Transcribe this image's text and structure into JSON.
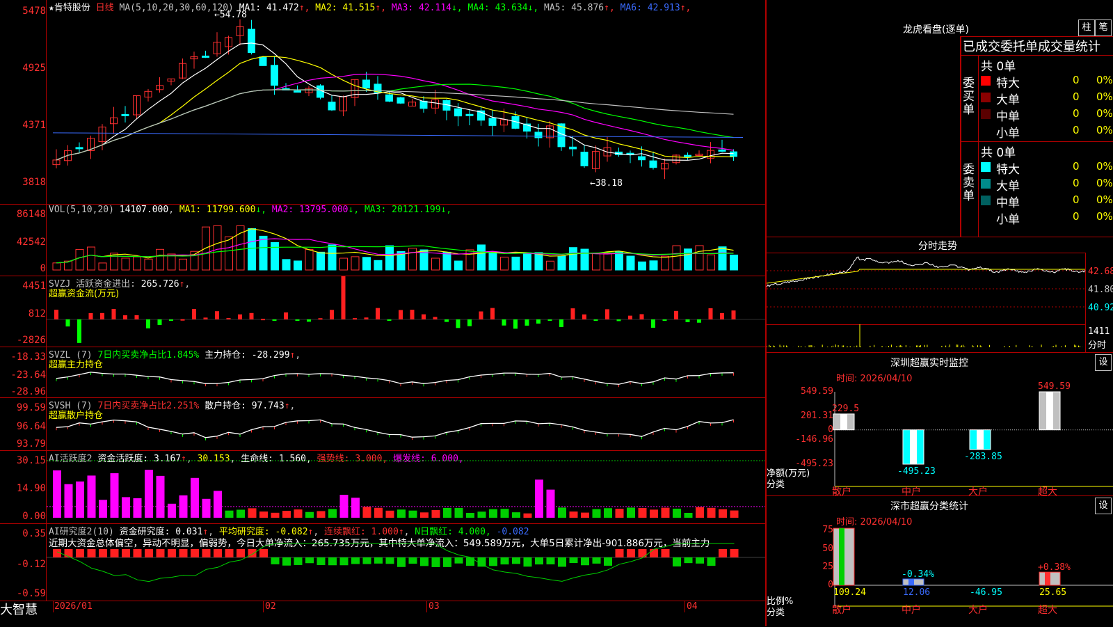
{
  "stock": {
    "star": "★",
    "name": "肯特股份",
    "period": "日线"
  },
  "ma_legend": {
    "label": "MA(5,10,20,30,60,120)",
    "items": [
      {
        "name": "MA1:",
        "value": "41.472",
        "arrow": "↑",
        "color": "#ffffff"
      },
      {
        "name": "MA2:",
        "value": "41.515",
        "arrow": "↑",
        "color": "#ffff00"
      },
      {
        "name": "MA3:",
        "value": "42.114",
        "arrow": "↓",
        "color": "#ff00ff"
      },
      {
        "name": "MA4:",
        "value": "43.634",
        "arrow": "↓",
        "color": "#00ff00"
      },
      {
        "name": "MA5:",
        "value": "45.876",
        "arrow": "↑",
        "color": "#c0c0c0"
      },
      {
        "name": "MA6:",
        "value": "42.913",
        "arrow": "↑",
        "color": "#3a6bff"
      }
    ]
  },
  "price_axis": [
    "5478",
    "4925",
    "4371",
    "3818"
  ],
  "price_markers": {
    "high": "54.78",
    "low": "38.18"
  },
  "vol_legend": {
    "label": "VOL(5,10,20)",
    "value": "14107.000",
    "items": [
      {
        "name": "MA1:",
        "value": "11799.600",
        "arrow": "↓",
        "color": "#ffff00"
      },
      {
        "name": "MA2:",
        "value": "13795.000",
        "arrow": "↓",
        "color": "#ff00ff"
      },
      {
        "name": "MA3:",
        "value": "20121.199",
        "arrow": "↓",
        "color": "#00ff00"
      }
    ]
  },
  "vol_axis": [
    "86148",
    "42542",
    "0"
  ],
  "svzj": {
    "title": "SVZJ  活跃资金进出:",
    "value": "265.726",
    "arrow": "↑",
    "sub": "超赢资金流(万元)"
  },
  "svzj_axis": [
    "4451",
    "812",
    "-2826"
  ],
  "svzl": {
    "title": "SVZL (7)",
    "desc": "7日内买卖净占比1.845%",
    "label": "主力持仓:",
    "value": "-28.299",
    "sub": "超赢主力持仓"
  },
  "svzl_axis": [
    "-18.33",
    "-23.64",
    "-28.96"
  ],
  "svsh": {
    "title": "SVSH (7)",
    "desc": "7日内买卖净占比2.251%",
    "label": "散户持仓:",
    "value": "97.743",
    "sub": "超赢散户持仓"
  },
  "svsh_axis": [
    "99.59",
    "96.64",
    "93.79"
  ],
  "ai_active": {
    "title": "AI活跃度2",
    "label": "资金活跃度:",
    "value": "3.167",
    "v2": "30.153",
    "life": "生命线: 1.560,",
    "strong": "强势线: 3.000,",
    "burst": "爆发线: 6.000,"
  },
  "ai_active_axis": [
    "30.15",
    "14.90",
    "0.00"
  ],
  "ai_research": {
    "title": "AI研究度2(10)",
    "label": "资金研究度:",
    "value": "0.031",
    "avg": "平均研究度: -0.082",
    "red": "连续飘红: 1.000",
    "nred": "N日飘红: 4.000,",
    "tail": "-0.082",
    "commentary": "近期大资金总体偏空，异动不明显，偏弱势，今日大单净流入：265.735万元，其中特大单净流入：549.589万元，大单5日累计净出-901.886万元，当前主力"
  },
  "ai_research_axis": [
    "0.35",
    "-0.12",
    "-0.59"
  ],
  "date_axis": [
    "2026/01",
    "02",
    "03",
    "04"
  ],
  "brand": "大智慧",
  "dragon_panel": {
    "title": "龙虎看盘(逐单)",
    "btn_col": "柱",
    "btn_pen": "笔",
    "header": "已成交委托单成交量统计",
    "buy_label": "委买单",
    "sell_label": "委卖单",
    "buy_total": "共 0单",
    "sell_total": "共 0单",
    "buy_rows": [
      {
        "label": "特大",
        "count": "0",
        "pct": "0%",
        "color": "#ff0000"
      },
      {
        "label": "大单",
        "count": "0",
        "pct": "0%",
        "color": "#8b0000"
      },
      {
        "label": "中单",
        "count": "0",
        "pct": "0%",
        "color": "#5a0000"
      },
      {
        "label": "小单",
        "count": "0",
        "pct": "0%",
        "color": "#000000"
      }
    ],
    "sell_rows": [
      {
        "label": "特大",
        "count": "0",
        "pct": "0%",
        "color": "#00ffff"
      },
      {
        "label": "大单",
        "count": "0",
        "pct": "0%",
        "color": "#008b8b"
      },
      {
        "label": "中单",
        "count": "0",
        "pct": "0%",
        "color": "#006060"
      },
      {
        "label": "小单",
        "count": "0",
        "pct": "0%",
        "color": "#000000"
      }
    ]
  },
  "intraday": {
    "title": "分时走势",
    "axis": [
      "42.68",
      "41.80",
      "40.92"
    ],
    "vol": "1411",
    "vol_unit": "分时"
  },
  "monitor": {
    "title": "深圳超赢实时监控",
    "btn": "设",
    "time": "时间: 2026/04/10",
    "axis": [
      "549.59",
      "201.31",
      "0",
      "-146.96",
      "-495.23"
    ],
    "ylabel": "净额(万元)",
    "xlabel": "分类",
    "bars": [
      {
        "cat": "散户",
        "value": 229.5,
        "label": "229.5"
      },
      {
        "cat": "中户",
        "value": -495.23,
        "label": "-495.23"
      },
      {
        "cat": "大户",
        "value": -283.85,
        "label": "-283.85"
      },
      {
        "cat": "超大",
        "value": 549.59,
        "label": "549.59"
      }
    ]
  },
  "classify": {
    "title": "深市超赢分类统计",
    "btn": "设",
    "time": "时间: 2026/04/10",
    "axis": [
      "75",
      "50",
      "25",
      "0"
    ],
    "ylabel": "比例%",
    "xlabel": "分类",
    "bars": [
      {
        "cat": "散户",
        "top": "",
        "bottom": "109.24",
        "pct": 100
      },
      {
        "cat": "中户",
        "top": "-0.34%",
        "bottom": "12.06",
        "pct": 11
      },
      {
        "cat": "大户",
        "top": "",
        "bottom": "-46.95",
        "pct": 0
      },
      {
        "cat": "超大",
        "top": "+0.38%",
        "bottom": "25.65",
        "pct": 23
      }
    ]
  }
}
